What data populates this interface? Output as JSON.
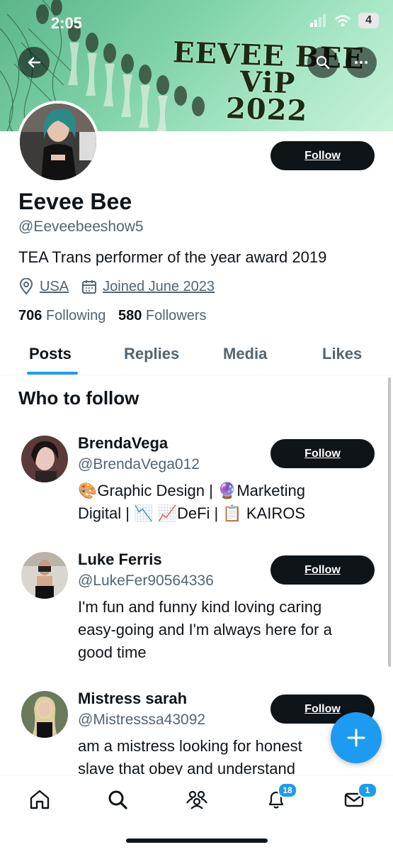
{
  "status_bar": {
    "time": "2:05",
    "battery": "4"
  },
  "banner": {
    "title_line1": "EEVEE BEE ViP",
    "title_line2": "2022"
  },
  "header_buttons": {
    "back_icon": "arrow-left-icon",
    "search_icon": "search-icon",
    "more_icon": "more-horizontal-icon"
  },
  "profile": {
    "name": "Eevee Bee",
    "handle": "@Eeveebeeshow5",
    "bio": "TEA Trans performer of the year award 2019",
    "location": "USA",
    "joined": "Joined June 2023",
    "following_count": "706",
    "following_label": "Following",
    "followers_count": "580",
    "followers_label": "Followers",
    "follow_label": "Follow"
  },
  "tabs": [
    {
      "label": "Posts",
      "active": true
    },
    {
      "label": "Replies",
      "active": false
    },
    {
      "label": "Media",
      "active": false
    },
    {
      "label": "Likes",
      "active": false
    }
  ],
  "who_to_follow": {
    "title": "Who to follow",
    "items": [
      {
        "name": "BrendaVega",
        "handle": "@BrendaVega012",
        "bio_line1": "🎨Graphic Design | 🔮Marketing",
        "bio_line2": "Digital | 📉 📈DeFi | 📋 KAIROS",
        "bio_line3": "",
        "follow": "Follow"
      },
      {
        "name": "Luke Ferris",
        "handle": "@LukeFer90564336",
        "bio_line1": "I'm fun and funny kind loving caring",
        "bio_line2": "easy-going and I'm always here for a",
        "bio_line3": "good time",
        "follow": "Follow"
      },
      {
        "name": "Mistress sarah",
        "handle": "@Mistresssa43092",
        "bio_line1": "am a mistress looking for honest",
        "bio_line2": "slave that obey and understand",
        "bio_line3": "",
        "follow": "Follow"
      }
    ]
  },
  "bottom_nav": {
    "notifications_badge": "18",
    "messages_badge": "1"
  },
  "colors": {
    "accent": "#1d9bf0",
    "text": "#0f1419",
    "secondary": "#536471"
  }
}
